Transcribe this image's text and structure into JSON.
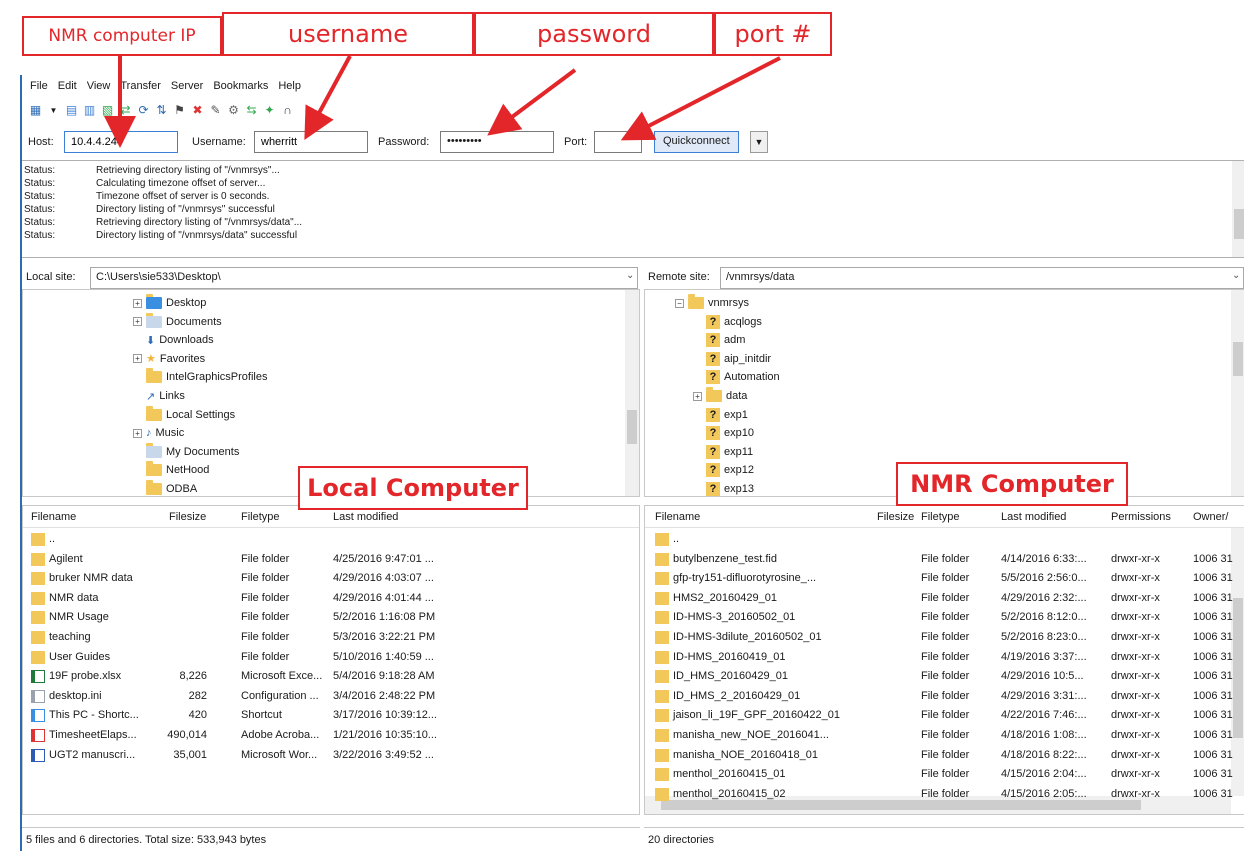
{
  "callouts": {
    "host": "NMR computer IP",
    "username": "username",
    "password": "password",
    "port": "port #",
    "local": "Local Computer",
    "remote": "NMR Computer"
  },
  "menu": [
    "File",
    "Edit",
    "View",
    "Transfer",
    "Server",
    "Bookmarks",
    "Help"
  ],
  "quickconnect": {
    "host_label": "Host:",
    "host_value": "10.4.4.244",
    "username_label": "Username:",
    "username_value": "wherritt",
    "password_label": "Password:",
    "password_value": "•••••••••",
    "port_label": "Port:",
    "port_value": "",
    "button": "Quickconnect",
    "dropdown": "▼"
  },
  "status_log": [
    {
      "k": "Status:",
      "v": "Retrieving directory listing of \"/vnmrsys\"..."
    },
    {
      "k": "Status:",
      "v": "Calculating timezone offset of server..."
    },
    {
      "k": "Status:",
      "v": "Timezone offset of server is 0 seconds."
    },
    {
      "k": "Status:",
      "v": "Directory listing of \"/vnmrsys\" successful"
    },
    {
      "k": "Status:",
      "v": "Retrieving directory listing of \"/vnmrsys/data\"..."
    },
    {
      "k": "Status:",
      "v": "Directory listing of \"/vnmrsys/data\" successful"
    }
  ],
  "local": {
    "site_label": "Local site:",
    "site_path": "C:\\Users\\sie533\\Desktop\\",
    "tree": [
      "Desktop",
      "Documents",
      "Downloads",
      "Favorites",
      "IntelGraphicsProfiles",
      "Links",
      "Local Settings",
      "Music",
      "My Documents",
      "NetHood",
      "ODBA"
    ],
    "headers": [
      "Filename",
      "Filesize",
      "Filetype",
      "Last modified"
    ],
    "files": [
      {
        "name": "..",
        "size": "",
        "type": "",
        "modified": ""
      },
      {
        "name": "Agilent",
        "size": "",
        "type": "File folder",
        "modified": "4/25/2016 9:47:01 ..."
      },
      {
        "name": "bruker NMR data",
        "size": "",
        "type": "File folder",
        "modified": "4/29/2016 4:03:07 ..."
      },
      {
        "name": "NMR data",
        "size": "",
        "type": "File folder",
        "modified": "4/29/2016 4:01:44 ..."
      },
      {
        "name": "NMR Usage",
        "size": "",
        "type": "File folder",
        "modified": "5/2/2016 1:16:08 PM"
      },
      {
        "name": "teaching",
        "size": "",
        "type": "File folder",
        "modified": "5/3/2016 3:22:21 PM"
      },
      {
        "name": "User Guides",
        "size": "",
        "type": "File folder",
        "modified": "5/10/2016 1:40:59 ..."
      },
      {
        "name": "19F probe.xlsx",
        "size": "8,226",
        "type": "Microsoft Exce...",
        "modified": "5/4/2016 9:18:28 AM"
      },
      {
        "name": "desktop.ini",
        "size": "282",
        "type": "Configuration ...",
        "modified": "3/4/2016 2:48:22 PM"
      },
      {
        "name": "This PC - Shortc...",
        "size": "420",
        "type": "Shortcut",
        "modified": "3/17/2016 10:39:12..."
      },
      {
        "name": "TimesheetElaps...",
        "size": "490,014",
        "type": "Adobe Acroba...",
        "modified": "1/21/2016 10:35:10..."
      },
      {
        "name": "UGT2 manuscri...",
        "size": "35,001",
        "type": "Microsoft Wor...",
        "modified": "3/22/2016 3:49:52 ..."
      }
    ],
    "status": "5 files and 6 directories. Total size: 533,943 bytes"
  },
  "remote": {
    "site_label": "Remote site:",
    "site_path": "/vnmrsys/data",
    "tree": [
      "vnmrsys",
      "acqlogs",
      "adm",
      "aip_initdir",
      "Automation",
      "data",
      "exp1",
      "exp10",
      "exp11",
      "exp12",
      "exp13"
    ],
    "headers": [
      "Filename",
      "Filesize",
      "Filetype",
      "Last modified",
      "Permissions",
      "Owner/"
    ],
    "files": [
      {
        "name": "..",
        "type": "",
        "modified": "",
        "perm": "",
        "owner": ""
      },
      {
        "name": "butylbenzene_test.fid",
        "type": "File folder",
        "modified": "4/14/2016 6:33:...",
        "perm": "drwxr-xr-x",
        "owner": "1006 31"
      },
      {
        "name": "gfp-try151-difluorotyrosine_...",
        "type": "File folder",
        "modified": "5/5/2016 2:56:0...",
        "perm": "drwxr-xr-x",
        "owner": "1006 31"
      },
      {
        "name": "HMS2_20160429_01",
        "type": "File folder",
        "modified": "4/29/2016 2:32:...",
        "perm": "drwxr-xr-x",
        "owner": "1006 31"
      },
      {
        "name": "ID-HMS-3_20160502_01",
        "type": "File folder",
        "modified": "5/2/2016 8:12:0...",
        "perm": "drwxr-xr-x",
        "owner": "1006 31"
      },
      {
        "name": "ID-HMS-3dilute_20160502_01",
        "type": "File folder",
        "modified": "5/2/2016 8:23:0...",
        "perm": "drwxr-xr-x",
        "owner": "1006 31"
      },
      {
        "name": "ID-HMS_20160419_01",
        "type": "File folder",
        "modified": "4/19/2016 3:37:...",
        "perm": "drwxr-xr-x",
        "owner": "1006 31"
      },
      {
        "name": "ID_HMS_20160429_01",
        "type": "File folder",
        "modified": "4/29/2016 10:5...",
        "perm": "drwxr-xr-x",
        "owner": "1006 31"
      },
      {
        "name": "ID_HMS_2_20160429_01",
        "type": "File folder",
        "modified": "4/29/2016 3:31:...",
        "perm": "drwxr-xr-x",
        "owner": "1006 31"
      },
      {
        "name": "jaison_li_19F_GPF_20160422_01",
        "type": "File folder",
        "modified": "4/22/2016 7:46:...",
        "perm": "drwxr-xr-x",
        "owner": "1006 31"
      },
      {
        "name": "manisha_new_NOE_2016041...",
        "type": "File folder",
        "modified": "4/18/2016 1:08:...",
        "perm": "drwxr-xr-x",
        "owner": "1006 31"
      },
      {
        "name": "manisha_NOE_20160418_01",
        "type": "File folder",
        "modified": "4/18/2016 8:22:...",
        "perm": "drwxr-xr-x",
        "owner": "1006 31"
      },
      {
        "name": "menthol_20160415_01",
        "type": "File folder",
        "modified": "4/15/2016 2:04:...",
        "perm": "drwxr-xr-x",
        "owner": "1006 31"
      },
      {
        "name": "menthol_20160415_02",
        "type": "File folder",
        "modified": "4/15/2016 2:05:...",
        "perm": "drwxr-xr-x",
        "owner": "1006 31"
      }
    ],
    "status": "20 directories"
  },
  "colors": {
    "callout": "#e3262a",
    "folder": "#f3c85a",
    "accent": "#3c7fd6"
  }
}
